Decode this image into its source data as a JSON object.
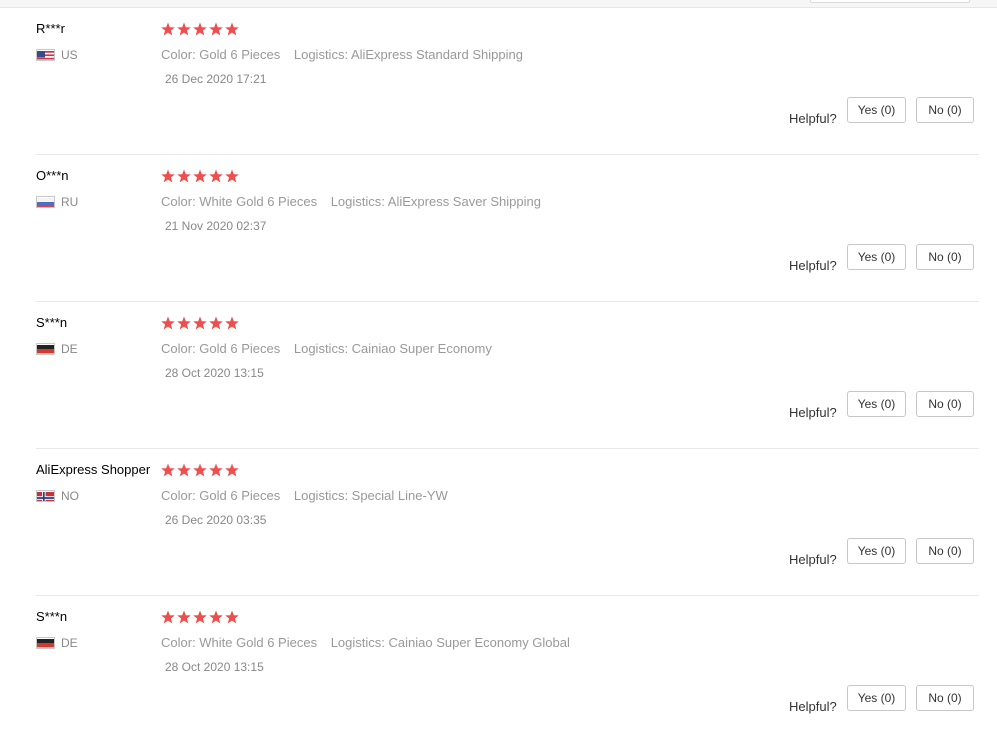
{
  "labels": {
    "helpful": "Helpful?"
  },
  "colors": {
    "star": "#f04d4d",
    "meta_text": "#999999"
  },
  "reviews": [
    {
      "user": "R***r",
      "country": "US",
      "flag_icon": "us-flag-icon",
      "rating": 5,
      "color": "Color: Gold 6 Pieces",
      "logistics": "Logistics: AliExpress Standard Shipping",
      "date": "26 Dec 2020 17:21",
      "yes": "Yes (0)",
      "no": "No (0)"
    },
    {
      "user": "O***n",
      "country": "RU",
      "flag_icon": "ru-flag-icon",
      "rating": 5,
      "color": "Color: White Gold 6 Pieces",
      "logistics": "Logistics: AliExpress Saver Shipping",
      "date": "21 Nov 2020 02:37",
      "yes": "Yes (0)",
      "no": "No (0)"
    },
    {
      "user": "S***n",
      "country": "DE",
      "flag_icon": "de-flag-icon",
      "rating": 5,
      "color": "Color: Gold 6 Pieces",
      "logistics": "Logistics: Cainiao Super Economy",
      "date": "28 Oct 2020 13:15",
      "yes": "Yes (0)",
      "no": "No (0)"
    },
    {
      "user": "AliExpress Shopper",
      "country": "NO",
      "flag_icon": "no-flag-icon",
      "rating": 5,
      "color": "Color: Gold 6 Pieces",
      "logistics": "Logistics: Special Line-YW",
      "date": "26 Dec 2020 03:35",
      "yes": "Yes (0)",
      "no": "No (0)"
    },
    {
      "user": "S***n",
      "country": "DE",
      "flag_icon": "de-flag-icon",
      "rating": 5,
      "color": "Color: White Gold 6 Pieces",
      "logistics": "Logistics: Cainiao Super Economy Global",
      "date": "28 Oct 2020 13:15",
      "yes": "Yes (0)",
      "no": "No (0)"
    }
  ]
}
